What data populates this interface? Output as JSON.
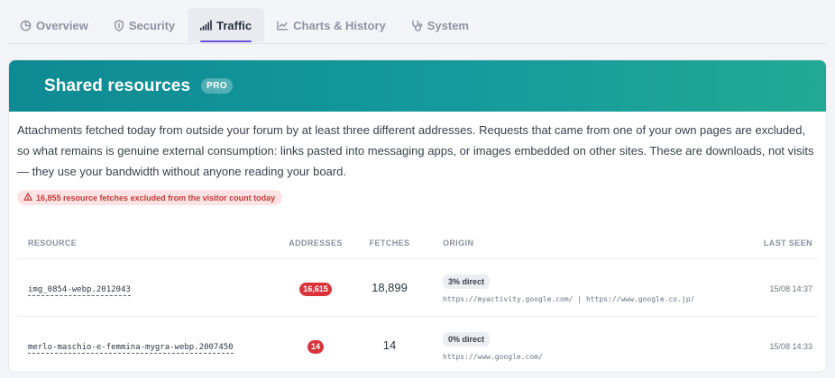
{
  "tabs": [
    {
      "label": "Overview",
      "icon": "pie-chart-icon",
      "active": false
    },
    {
      "label": "Security",
      "icon": "shield-icon",
      "active": false
    },
    {
      "label": "Traffic",
      "icon": "signal-bars-icon",
      "active": true
    },
    {
      "label": "Charts & History",
      "icon": "line-chart-icon",
      "active": false
    },
    {
      "label": "System",
      "icon": "stethoscope-icon",
      "active": false
    }
  ],
  "card": {
    "title": "Shared resources",
    "badge": "PRO",
    "description": "Attachments fetched today from outside your forum by at least three different addresses. Requests that came from one of your own pages are excluded, so what remains is genuine external consumption: links pasted into messaging apps, or images embedded on other sites. These are downloads, not visits — they use your bandwidth without anyone reading your board.",
    "warning": "16,855 resource fetches excluded from the visitor count today"
  },
  "table": {
    "headers": {
      "resource": "RESOURCE",
      "addresses": "ADDRESSES",
      "fetches": "FETCHES",
      "origin": "ORIGIN",
      "last_seen": "LAST SEEN"
    },
    "rows": [
      {
        "resource": "img_0854-webp.2012043",
        "addresses": "16,615",
        "fetches": "18,899",
        "origin_badge": "3% direct",
        "origin_urls": "https://myactivity.google.com/ | https://www.google.co.jp/",
        "last_seen": "15/08 14:37"
      },
      {
        "resource": "merlo-maschio-e-femmina-mygra-webp.2007450",
        "addresses": "14",
        "fetches": "14",
        "origin_badge": "0% direct",
        "origin_urls": "https://www.google.com/",
        "last_seen": "15/08 14:33"
      }
    ]
  },
  "colors": {
    "accent": "#6b4fd8",
    "banner_start": "#0e8a93",
    "banner_end": "#22a994",
    "danger": "#d8353a"
  }
}
